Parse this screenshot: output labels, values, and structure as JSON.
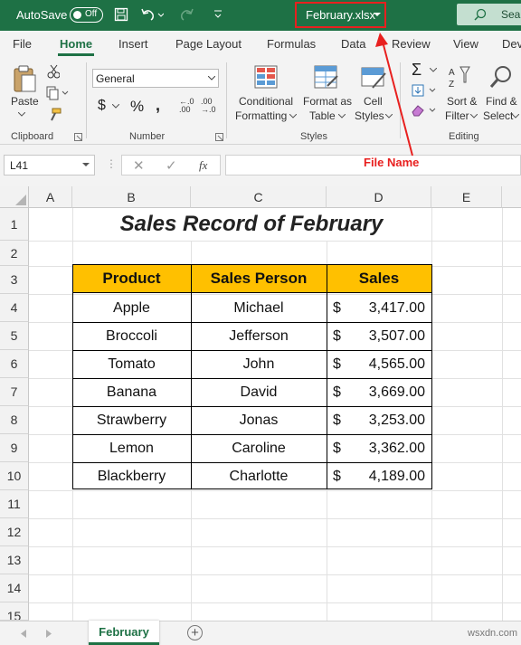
{
  "titlebar": {
    "autosave_label": "AutoSave",
    "autosave_state": "Off",
    "file_name": "February.xlsx",
    "search_label": "Sear"
  },
  "menu": {
    "tabs": [
      "File",
      "Home",
      "Insert",
      "Page Layout",
      "Formulas",
      "Data",
      "Review",
      "View",
      "Dev"
    ]
  },
  "ribbon": {
    "paste_label": "Paste",
    "number_format": "General",
    "conditional": [
      "Conditional",
      "Formatting"
    ],
    "format_table": [
      "Format as",
      "Table"
    ],
    "cell_styles": [
      "Cell",
      "Styles"
    ],
    "sort_filter": [
      "Sort &",
      "Filter"
    ],
    "find_select": [
      "Find &",
      "Select"
    ],
    "groups": {
      "clipboard": "Clipboard",
      "number": "Number",
      "styles": "Styles",
      "editing": "Editing"
    }
  },
  "annotation": {
    "label": "File Name",
    "color": "#e8201f"
  },
  "formula_bar": {
    "name_box": "L41",
    "fx": "fx"
  },
  "grid": {
    "columns": [
      "A",
      "B",
      "C",
      "D",
      "E"
    ],
    "rows": [
      "1",
      "2",
      "3",
      "4",
      "5",
      "6",
      "7",
      "8",
      "9",
      "10",
      "11",
      "12",
      "13",
      "14",
      "15"
    ],
    "title": "Sales Record of February",
    "headers": [
      "Product",
      "Sales Person",
      "Sales"
    ],
    "header_color": "#ffc000",
    "records": [
      {
        "product": "Apple",
        "person": "Michael",
        "currency": "$",
        "sales": "3,417.00"
      },
      {
        "product": "Broccoli",
        "person": "Jefferson",
        "currency": "$",
        "sales": "3,507.00"
      },
      {
        "product": "Tomato",
        "person": "John",
        "currency": "$",
        "sales": "4,565.00"
      },
      {
        "product": "Banana",
        "person": "David",
        "currency": "$",
        "sales": "3,669.00"
      },
      {
        "product": "Strawberry",
        "person": "Jonas",
        "currency": "$",
        "sales": "3,253.00"
      },
      {
        "product": "Lemon",
        "person": "Caroline",
        "currency": "$",
        "sales": "3,362.00"
      },
      {
        "product": "Blackberry",
        "person": "Charlotte",
        "currency": "$",
        "sales": "4,189.00"
      }
    ]
  },
  "sheet_tabs": {
    "active": "February",
    "add_symbol": "+"
  },
  "watermark": "wsxdn.com"
}
